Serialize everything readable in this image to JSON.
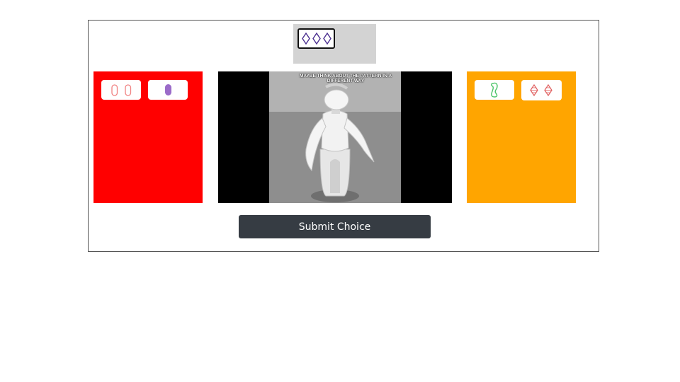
{
  "target": {
    "card": {
      "count": 3,
      "shape": "diamond",
      "color": "#4b2f8f",
      "fill": "none"
    }
  },
  "panels": {
    "left": {
      "color": "#ff0000",
      "cards": [
        {
          "count": 2,
          "shape": "oval",
          "color": "#f08080",
          "fill": "none"
        },
        {
          "count": 1,
          "shape": "oval",
          "color": "#9b6bc9",
          "fill": "solid"
        }
      ]
    },
    "right": {
      "color": "#ffa500",
      "cards": [
        {
          "count": 1,
          "shape": "squiggle",
          "color": "#4cc46a",
          "fill": "none"
        },
        {
          "count": 2,
          "shape": "diamond",
          "color": "#e06060",
          "fill": "striped"
        }
      ]
    }
  },
  "video": {
    "caption": "MAYBE THINK ABOUT THE PATTERN IN A DIFFERENT WAY"
  },
  "submit_label": "Submit Choice"
}
